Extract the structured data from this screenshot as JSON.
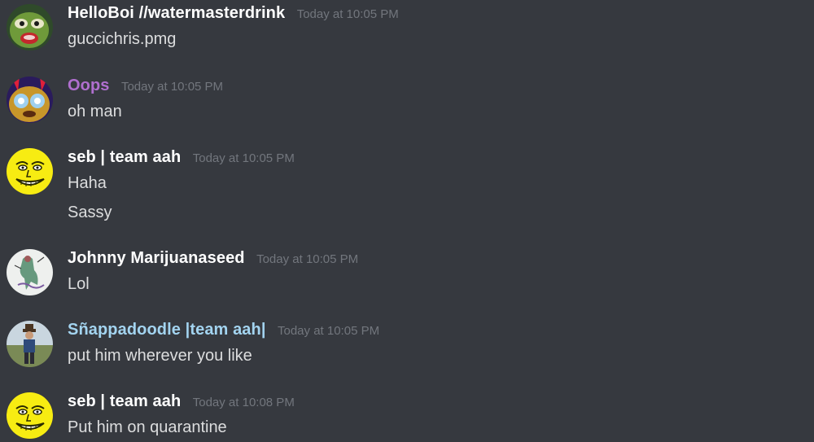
{
  "messages": [
    {
      "username": "HelloBoi //watermasterdrink",
      "name_color": "#ffffff",
      "timestamp": "Today at 10:05 PM",
      "avatar_icon": "frog-face-avatar",
      "lines": [
        "guccichris.pmg"
      ]
    },
    {
      "username": "Oops",
      "name_color": "#b06fcf",
      "timestamp": "Today at 10:05 PM",
      "avatar_icon": "fnaf-pikachu-avatar",
      "lines": [
        "oh man"
      ]
    },
    {
      "username": "seb | team aah",
      "name_color": "#ffffff",
      "timestamp": "Today at 10:05 PM",
      "avatar_icon": "yellow-meme-face-avatar",
      "lines": [
        "Haha",
        "Sassy"
      ]
    },
    {
      "username": "Johnny Marijuanaseed",
      "name_color": "#ffffff",
      "timestamp": "Today at 10:05 PM",
      "avatar_icon": "sketch-figure-avatar",
      "lines": [
        "Lol"
      ]
    },
    {
      "username": "Sñappadoodle |team aah|",
      "name_color": "#a3d4f0",
      "timestamp": "Today at 10:05 PM",
      "avatar_icon": "cowboy-photo-avatar",
      "lines": [
        "put him wherever you like"
      ]
    },
    {
      "username": "seb | team aah",
      "name_color": "#ffffff",
      "timestamp": "Today at 10:08 PM",
      "avatar_icon": "yellow-meme-face-avatar",
      "lines": [
        "Put him on quarantine"
      ]
    }
  ]
}
